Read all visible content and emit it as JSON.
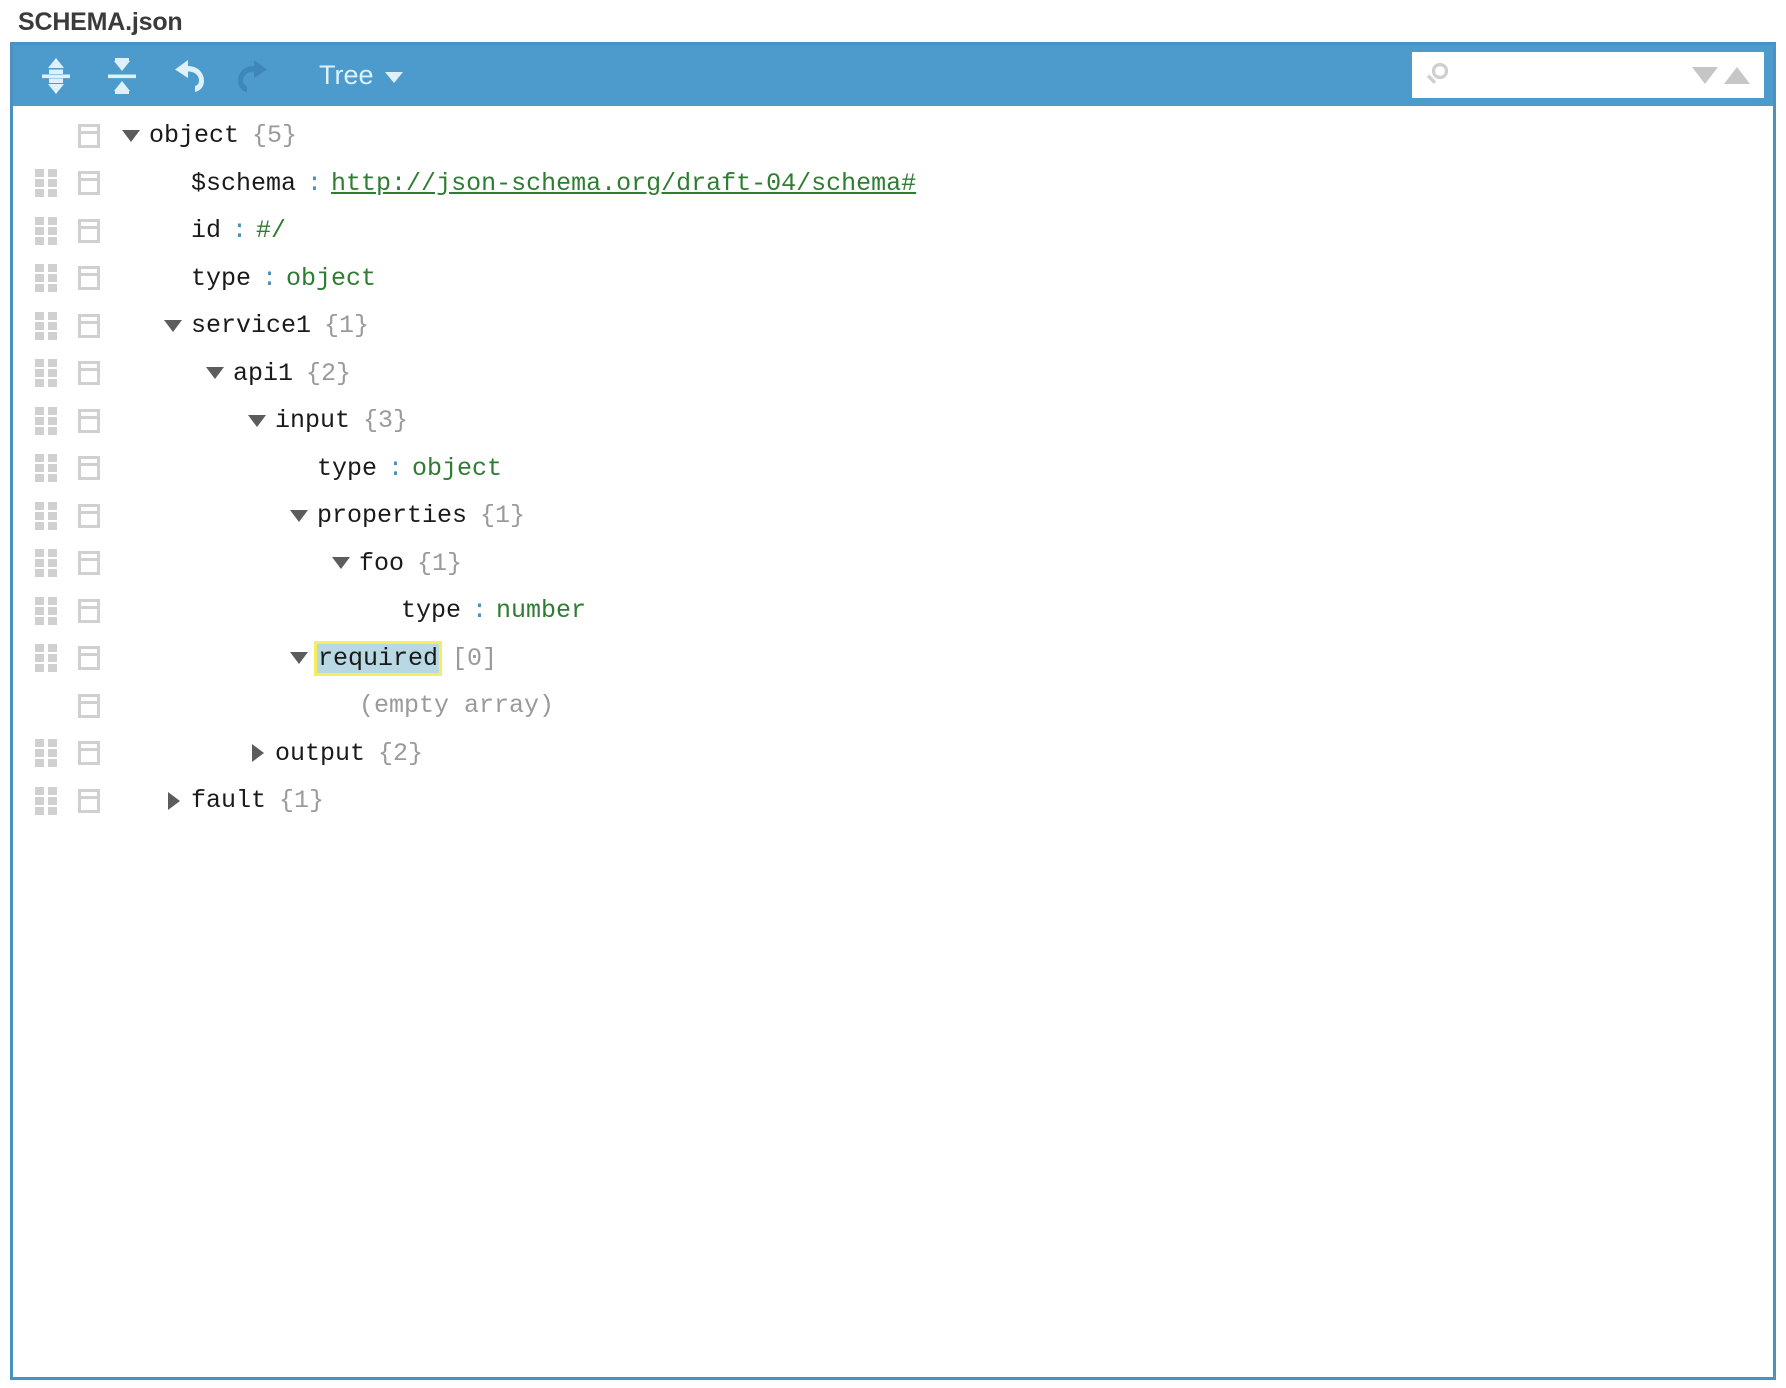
{
  "title": "SCHEMA.json",
  "toolbar": {
    "expand_all_label": "Expand all fields",
    "collapse_all_label": "Collapse all fields",
    "undo_label": "Undo last action",
    "redo_label": "Redo",
    "mode_label": "Tree",
    "accent_color": "#4c9bcc",
    "border_color": "#4a92c4"
  },
  "search": {
    "placeholder": "",
    "value": "",
    "icon": "search-icon",
    "next_label": "Next result",
    "previous_label": "Previous result"
  },
  "tree": {
    "selection": {
      "key": "required",
      "highlight_color": "#f5ef5a",
      "selection_color": "#b8d8e3"
    },
    "rows": [
      {
        "indent": 0,
        "expander": "open",
        "key": "object",
        "separator": "",
        "value": "",
        "value_type": "none",
        "count": "{5}",
        "drag": false,
        "selected": false
      },
      {
        "indent": 1,
        "expander": "none",
        "key": "$schema",
        "separator": ":",
        "value": "http://json-schema.org/draft-04/schema#",
        "value_type": "link",
        "count": "",
        "drag": true,
        "selected": false
      },
      {
        "indent": 1,
        "expander": "none",
        "key": "id",
        "separator": ":",
        "value": "#/",
        "value_type": "string",
        "count": "",
        "drag": true,
        "selected": false
      },
      {
        "indent": 1,
        "expander": "none",
        "key": "type",
        "separator": ":",
        "value": "object",
        "value_type": "string",
        "count": "",
        "drag": true,
        "selected": false
      },
      {
        "indent": 1,
        "expander": "open",
        "key": "service1",
        "separator": "",
        "value": "",
        "value_type": "none",
        "count": "{1}",
        "drag": true,
        "selected": false
      },
      {
        "indent": 2,
        "expander": "open",
        "key": "api1",
        "separator": "",
        "value": "",
        "value_type": "none",
        "count": "{2}",
        "drag": true,
        "selected": false
      },
      {
        "indent": 3,
        "expander": "open",
        "key": "input",
        "separator": "",
        "value": "",
        "value_type": "none",
        "count": "{3}",
        "drag": true,
        "selected": false
      },
      {
        "indent": 4,
        "expander": "none",
        "key": "type",
        "separator": ":",
        "value": "object",
        "value_type": "string",
        "count": "",
        "drag": true,
        "selected": false
      },
      {
        "indent": 4,
        "expander": "open",
        "key": "properties",
        "separator": "",
        "value": "",
        "value_type": "none",
        "count": "{1}",
        "drag": true,
        "selected": false
      },
      {
        "indent": 5,
        "expander": "open",
        "key": "foo",
        "separator": "",
        "value": "",
        "value_type": "none",
        "count": "{1}",
        "drag": true,
        "selected": false
      },
      {
        "indent": 6,
        "expander": "none",
        "key": "type",
        "separator": ":",
        "value": "number",
        "value_type": "string",
        "count": "",
        "drag": true,
        "selected": false
      },
      {
        "indent": 4,
        "expander": "open",
        "key": "required",
        "separator": "",
        "value": "",
        "value_type": "none",
        "count": "[0]",
        "drag": true,
        "selected": true
      },
      {
        "indent": 5,
        "expander": "none",
        "key": "",
        "separator": "",
        "value": "(empty array)",
        "value_type": "empty",
        "count": "",
        "drag": false,
        "selected": false
      },
      {
        "indent": 3,
        "expander": "closed",
        "key": "output",
        "separator": "",
        "value": "",
        "value_type": "none",
        "count": "{2}",
        "drag": true,
        "selected": false
      },
      {
        "indent": 1,
        "expander": "closed",
        "key": "fault",
        "separator": "",
        "value": "",
        "value_type": "none",
        "count": "{1}",
        "drag": true,
        "selected": false
      }
    ]
  }
}
